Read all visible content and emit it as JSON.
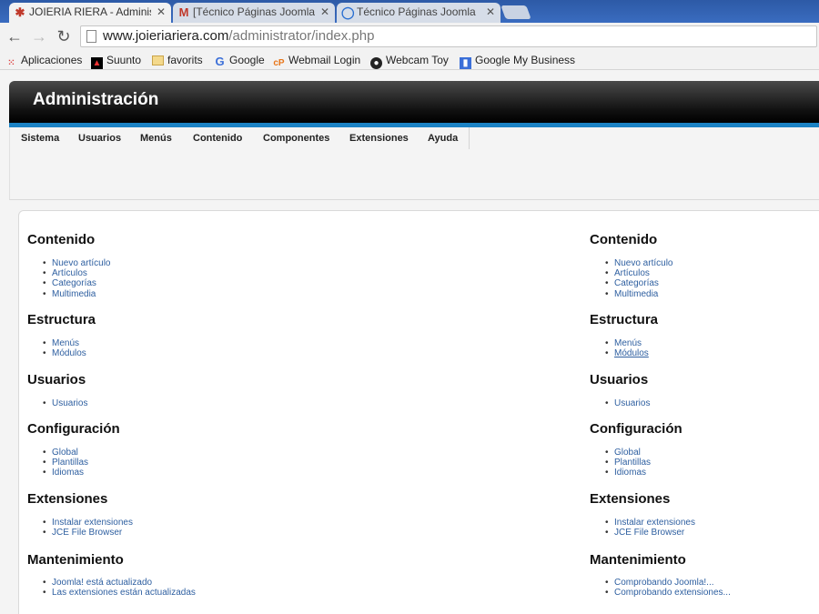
{
  "browser": {
    "tabs": [
      {
        "title": "JOIERIA RIERA - Administr",
        "icon": "joomla-logo-icon",
        "active": true
      },
      {
        "title": "[Técnico Páginas Joomla]",
        "icon": "gmail-icon",
        "active": false
      },
      {
        "title": "Técnico Páginas Joomla",
        "icon": "google-search-icon",
        "active": false
      }
    ],
    "url_host": "www.joieriariera.com",
    "url_path": "/administrator/index.php",
    "bookmarks": [
      {
        "label": "Aplicaciones",
        "icon": "apps-grid-icon"
      },
      {
        "label": "Suunto",
        "icon": "suunto-icon"
      },
      {
        "label": "favorits",
        "icon": "folder-icon"
      },
      {
        "label": "Google",
        "icon": "google-icon"
      },
      {
        "label": "Webmail Login",
        "icon": "webmail-icon"
      },
      {
        "label": "Webcam Toy",
        "icon": "webcam-icon"
      },
      {
        "label": "Google My Business",
        "icon": "google-my-business-icon"
      }
    ]
  },
  "admin": {
    "title": "Administración",
    "menu": [
      "Sistema",
      "Usuarios",
      "Menús",
      "Contenido",
      "Componentes",
      "Extensiones",
      "Ayuda"
    ]
  },
  "left_column": [
    {
      "heading": "Contenido",
      "links": [
        "Nuevo artículo",
        "Artículos",
        "Categorías",
        "Multimedia"
      ]
    },
    {
      "heading": "Estructura",
      "links": [
        "Menús",
        "Módulos"
      ]
    },
    {
      "heading": "Usuarios",
      "links": [
        "Usuarios"
      ]
    },
    {
      "heading": "Configuración",
      "links": [
        "Global",
        "Plantillas",
        "Idiomas"
      ]
    },
    {
      "heading": "Extensiones",
      "links": [
        "Instalar extensiones",
        "JCE File Browser"
      ]
    },
    {
      "heading": "Mantenimiento",
      "links": [
        "Joomla! está actualizado",
        "Las extensiones están actualizadas"
      ]
    }
  ],
  "right_column": [
    {
      "heading": "Contenido",
      "links": [
        "Nuevo artículo",
        "Artículos",
        "Categorías",
        "Multimedia"
      ]
    },
    {
      "heading": "Estructura",
      "links": [
        "Menús",
        "Módulos"
      ]
    },
    {
      "heading": "Usuarios",
      "links": [
        "Usuarios"
      ]
    },
    {
      "heading": "Configuración",
      "links": [
        "Global",
        "Plantillas",
        "Idiomas"
      ]
    },
    {
      "heading": "Extensiones",
      "links": [
        "Instalar extensiones",
        "JCE File Browser"
      ]
    },
    {
      "heading": "Mantenimiento",
      "links": [
        "Comprobando Joomla!...",
        "Comprobando extensiones..."
      ]
    }
  ],
  "colors": {
    "accent_stripe": "#1b82c4",
    "link": "#2e5fa0",
    "header": "#111111"
  }
}
